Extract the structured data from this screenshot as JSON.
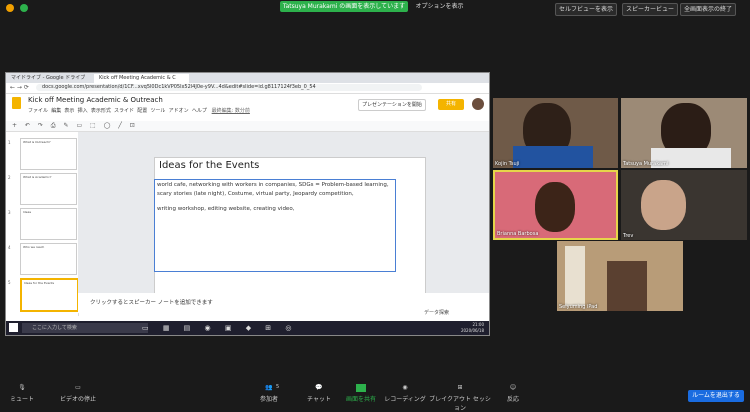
{
  "zoom": {
    "share_banner": "Tatsuya Murakami の画面を表示しています",
    "options_label": "オプションを表示",
    "self_view_btn": "セルフビューを表示",
    "speaker_view_btn": "スピーカービュー",
    "exit_fullscreen_btn": "全画面表示の終了",
    "participants": [
      {
        "name": "Kojin Tsuji"
      },
      {
        "name": "Tatsuya Murakami"
      },
      {
        "name": "Brianna Barbosa"
      },
      {
        "name": "Trev"
      },
      {
        "name": "Seiyuming iPad"
      }
    ],
    "bottom": {
      "mute": "ミュート",
      "stop_video": "ビデオの停止",
      "participants": "参加者",
      "participant_count": "5",
      "chat": "チャット",
      "share_screen": "画面を共有",
      "record": "レコーディング",
      "breakout": "ブレイクアウト セッション",
      "reactions": "反応",
      "end": "ルームを退出する"
    }
  },
  "browser": {
    "tabs": [
      "マイドライブ - Google ドライブ",
      "Kick off Meeting Academic & C"
    ],
    "url": "docs.google.com/presentation/d/1CF...xvq5l0Dc1kVP05lx52l4J0e-y9V...4d&edit#slide=id.g8117124f3eb_0_54"
  },
  "slides": {
    "doc_title": "Kick off Meeting Academic & Outreach",
    "menu": [
      "ファイル",
      "編集",
      "表示",
      "挿入",
      "表示形式",
      "スライド",
      "配置",
      "ツール",
      "アドオン",
      "ヘルプ",
      "最終編集: 数分前"
    ],
    "present_btn": "プレゼンテーションを開始",
    "share_btn": "共有",
    "slide_title": "Ideas for the Events",
    "slide_body_1": "world cafe, networking with workers in companies, SDGs = Problem-based learning, scary stories (late night), Costume, virtual party, Jeopardy competition,",
    "slide_body_2": "writing workshop, editing website, creating video,",
    "notes_placeholder": "クリックするとスピーカー ノートを追加できます",
    "explore_label": "データ探索",
    "thumb_titles": [
      "What is Outreach?",
      "What is Academic?",
      "Ideas",
      "Who we reach",
      "Ideas for the Events"
    ]
  },
  "taskbar": {
    "search_placeholder": "ここに入力して検索",
    "time": "21:00",
    "date": "2020/06/18"
  }
}
